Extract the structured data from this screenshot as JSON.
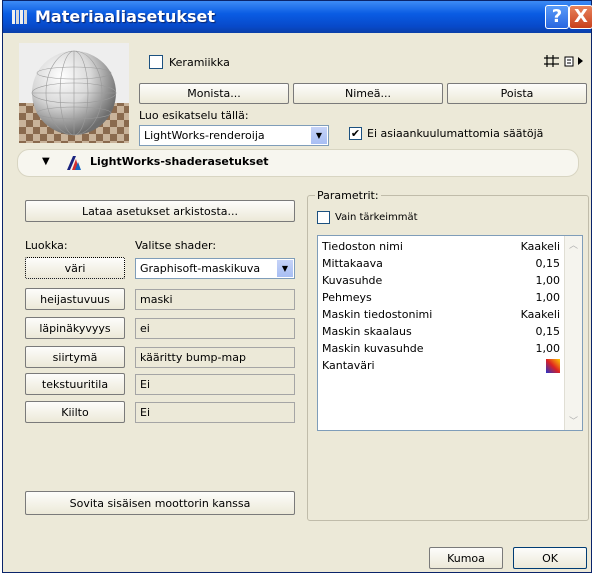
{
  "window": {
    "title": "Materiaaliasetukset",
    "help": "?",
    "close": "X"
  },
  "top": {
    "material_name": "Keramiikka",
    "duplicate_label": "Monista...",
    "rename_label": "Nimeä...",
    "delete_label": "Poista",
    "preview_label": "Luo esikatselu tällä:",
    "preview_engine": "LightWorks-renderoija",
    "no_irrelevant_label": "Ei asiaankuulumattomia säätöjä",
    "no_irrelevant_checked": "✔"
  },
  "section": {
    "title": "LightWorks-shaderasetukset"
  },
  "left": {
    "load_label": "Lataa asetukset arkistosta...",
    "class_header": "Luokka:",
    "shader_header": "Valitse shader:",
    "rows": [
      {
        "class": "väri",
        "shader": "Graphisoft-maskikuva"
      },
      {
        "class": "heijastuvuus",
        "shader": "maski"
      },
      {
        "class": "läpinäkyvyys",
        "shader": "ei"
      },
      {
        "class": "siirtymä",
        "shader": "kääritty bump-map"
      },
      {
        "class": "tekstuuritila",
        "shader": "Ei"
      },
      {
        "class": "Kiilto",
        "shader": "Ei"
      }
    ],
    "sync_label": "Sovita sisäisen moottorin kanssa"
  },
  "params": {
    "group_label": "Parametrit:",
    "essential_label": "Vain tärkeimmät",
    "rows": [
      {
        "key": "Tiedoston nimi",
        "value": "Kaakeli"
      },
      {
        "key": "Mittakaava",
        "value": "0,15"
      },
      {
        "key": "Kuvasuhde",
        "value": "1,00"
      },
      {
        "key": "Pehmeys",
        "value": "1,00"
      },
      {
        "key": "Maskin tiedostonimi",
        "value": "Kaakeli"
      },
      {
        "key": "Maskin skaalaus",
        "value": "0,15"
      },
      {
        "key": "Maskin kuvasuhde",
        "value": "1,00"
      },
      {
        "key": "Kantaväri",
        "value": ""
      }
    ]
  },
  "footer": {
    "cancel_label": "Kumoa",
    "ok_label": "OK"
  }
}
